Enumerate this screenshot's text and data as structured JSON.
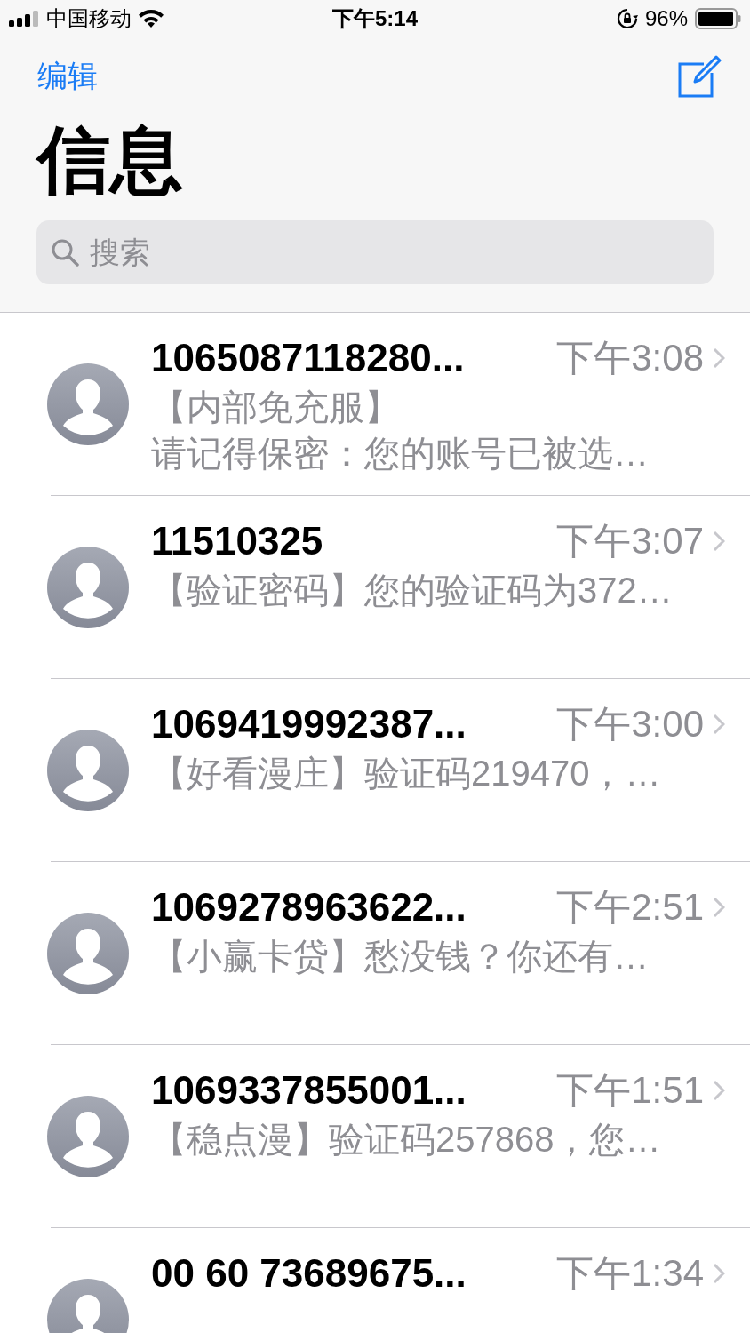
{
  "status_bar": {
    "carrier": "中国移动",
    "time": "下午5:14",
    "battery": "96%"
  },
  "nav": {
    "edit": "编辑",
    "title": "信息"
  },
  "search": {
    "placeholder": "搜索"
  },
  "conversations": [
    {
      "name": "1065087118280...",
      "time": "下午3:08",
      "preview": [
        "【内部免充服】",
        "请记得保密：您的账号已被选…"
      ]
    },
    {
      "name": "11510325",
      "time": "下午3:07",
      "preview": [
        "【验证密码】您的验证码为372…"
      ]
    },
    {
      "name": "1069419992387...",
      "time": "下午3:00",
      "preview": [
        "【好看漫庄】验证码219470，…"
      ]
    },
    {
      "name": "1069278963622...",
      "time": "下午2:51",
      "preview": [
        "【小赢卡贷】愁没钱？你还有…"
      ]
    },
    {
      "name": "1069337855001...",
      "time": "下午1:51",
      "preview": [
        "【稳点漫】验证码257868，您…"
      ]
    },
    {
      "name": "00 60 73689675...",
      "time": "下午1:34"
    }
  ]
}
